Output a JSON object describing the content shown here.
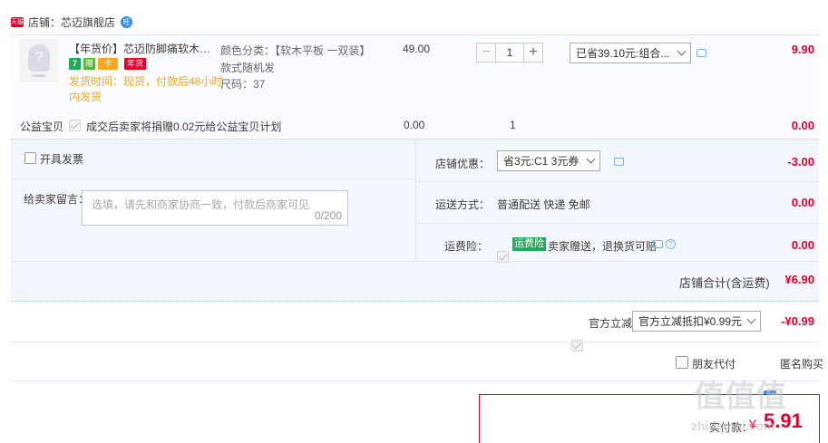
{
  "shop": {
    "badge": "天猫",
    "label": "店铺：芯迈旗舰店",
    "wangwang": "旺"
  },
  "item": {
    "thumb_caption": "XINMAI",
    "title": "【年货价】芯迈防脚痛软木鞋垫...",
    "icons": {
      "seven": "7",
      "badge2": "赠",
      "card": "卡",
      "newyear": "年货"
    },
    "ship_line1": "发货时间：现货，付款后48小时",
    "ship_line2": "内发货",
    "sku_color": "颜色分类：【软木平板 一双装】",
    "sku_style": "款式随机发",
    "sku_size": "尺码：37",
    "price": "49.00",
    "minus": "−",
    "qty": "1",
    "plus": "+",
    "promo_select": "已省39.10元:组合...",
    "subtotal": "9.90"
  },
  "charity": {
    "label": "公益宝贝",
    "text": "成交后卖家将捐赠0.02元给公益宝贝计划",
    "price": "0.00",
    "qty": "1",
    "subtotal": "0.00"
  },
  "invoice": {
    "label": "开具发票"
  },
  "message": {
    "label": "给卖家留言：",
    "placeholder": "选填，请先和商家协商一致，付款后商家可见",
    "counter": "0/200"
  },
  "coupon": {
    "label": "店铺优惠：",
    "select": "省3元:C1 3元券",
    "amount": "-3.00"
  },
  "shipping": {
    "label": "运送方式：",
    "value": "普通配送 快递 免邮",
    "amount": "0.00"
  },
  "insurance": {
    "label": "运费险：",
    "tag": "运费险",
    "text": "卖家赠送，退换货可赔",
    "qmark": "?",
    "amount": "0.00"
  },
  "shop_total": {
    "label": "店铺合计(含运费)",
    "amount": "¥6.90"
  },
  "official": {
    "label": "官方立减",
    "select": "官方立减抵扣¥0.99元",
    "amount": "-¥0.99"
  },
  "options": {
    "friend_pay": "朋友代付",
    "anonymous": "匿名购买"
  },
  "pay": {
    "label": "实付款：",
    "currency": "¥",
    "amount": "5.91"
  },
  "watermark": {
    "big": "值值值",
    "small": "zhidemai.com"
  }
}
